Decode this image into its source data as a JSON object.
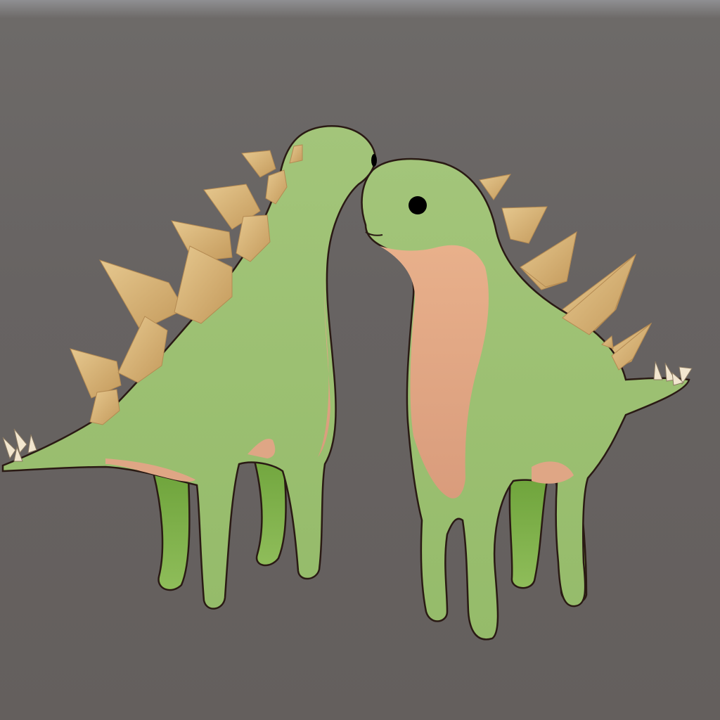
{
  "scene": {
    "subject_count": 2,
    "colors": {
      "background": "#666260",
      "body": "#9dc174",
      "body_shade": "#7faa53",
      "belly": "#e0a784",
      "plates": "#d7b57c",
      "plates_shade": "#c39b5d",
      "outline": "#2a1a14",
      "eye": "#000000",
      "tail_spikes": "#f2e6cf"
    },
    "icons": [
      "stegosaurus-left",
      "stegosaurus-right"
    ]
  }
}
